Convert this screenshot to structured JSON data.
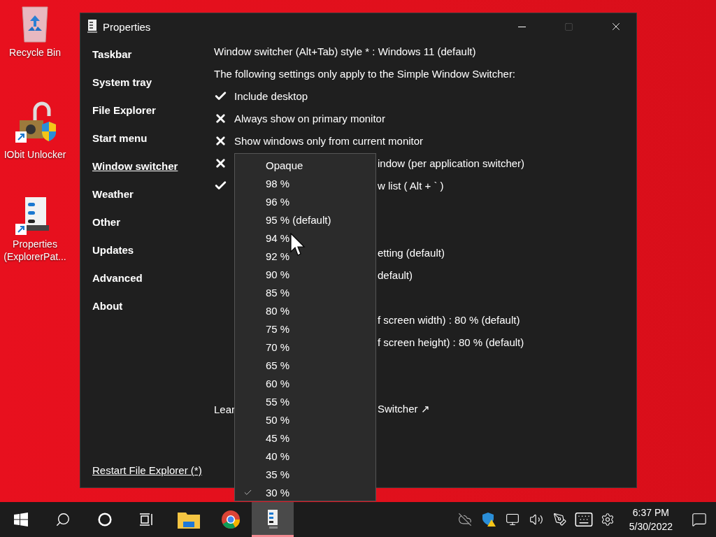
{
  "desktop_icons": [
    {
      "kind": "recycle",
      "label": "Recycle Bin"
    },
    {
      "kind": "unlocker",
      "label": "IObit Unlocker"
    },
    {
      "kind": "properties",
      "label": "Properties (ExplorerPat..."
    }
  ],
  "window": {
    "title": "Properties",
    "sidebar": [
      {
        "label": "Taskbar",
        "selected": false
      },
      {
        "label": "System tray",
        "selected": false
      },
      {
        "label": "File Explorer",
        "selected": false
      },
      {
        "label": "Start menu",
        "selected": false
      },
      {
        "label": "Window switcher",
        "selected": true
      },
      {
        "label": "Weather",
        "selected": false
      },
      {
        "label": "Other",
        "selected": false
      },
      {
        "label": "Updates",
        "selected": false
      },
      {
        "label": "Advanced",
        "selected": false
      },
      {
        "label": "About",
        "selected": false
      }
    ],
    "restart_link": "Restart File Explorer (*)",
    "settings": [
      {
        "kind": "text",
        "text": "Window switcher (Alt+Tab) style * : Windows 11 (default)"
      },
      {
        "kind": "text",
        "text": "The following settings only apply to the Simple Window Switcher:"
      },
      {
        "kind": "check",
        "text": "Include desktop",
        "checked": true
      },
      {
        "kind": "check",
        "text": "Always show on primary monitor",
        "checked": false
      },
      {
        "kind": "check",
        "text": "Show windows only from current monitor",
        "checked": false
      },
      {
        "kind": "check",
        "tail": "indow (per application switcher)",
        "checked": false
      },
      {
        "kind": "check",
        "tail": "w list ( Alt + ` )",
        "checked": true
      },
      {
        "kind": "blank"
      },
      {
        "kind": "blank"
      },
      {
        "kind": "option",
        "tail": "etting (default)"
      },
      {
        "kind": "option",
        "tail": "default)"
      },
      {
        "kind": "blank"
      },
      {
        "kind": "option",
        "tail": "f screen width) : 80 % (default)"
      },
      {
        "kind": "option",
        "tail": "f screen height) : 80 % (default)"
      },
      {
        "kind": "blank"
      },
      {
        "kind": "blank"
      },
      {
        "kind": "link",
        "text": "Lear",
        "tail": "Switcher ↗"
      }
    ],
    "dropdown": {
      "items": [
        {
          "label": "Opaque",
          "selected": false
        },
        {
          "label": "98 %",
          "selected": false
        },
        {
          "label": "96 %",
          "selected": false
        },
        {
          "label": "95 % (default)",
          "selected": false
        },
        {
          "label": "94 %",
          "selected": false
        },
        {
          "label": "92 %",
          "selected": false
        },
        {
          "label": "90 %",
          "selected": false
        },
        {
          "label": "85 %",
          "selected": false
        },
        {
          "label": "80 %",
          "selected": false
        },
        {
          "label": "75 %",
          "selected": false
        },
        {
          "label": "70 %",
          "selected": false
        },
        {
          "label": "65 %",
          "selected": false
        },
        {
          "label": "60 %",
          "selected": false
        },
        {
          "label": "55 %",
          "selected": false
        },
        {
          "label": "50 %",
          "selected": false
        },
        {
          "label": "45 %",
          "selected": false
        },
        {
          "label": "40 %",
          "selected": false
        },
        {
          "label": "35 %",
          "selected": false
        },
        {
          "label": "30 %",
          "selected": true
        }
      ]
    }
  },
  "taskbar": {
    "apps": [
      {
        "kind": "start",
        "selected": false
      },
      {
        "kind": "search",
        "selected": false
      },
      {
        "kind": "cortana",
        "selected": false
      },
      {
        "kind": "taskview",
        "selected": false
      },
      {
        "kind": "explorer",
        "selected": false
      },
      {
        "kind": "chrome",
        "selected": false
      },
      {
        "kind": "properties",
        "selected": true
      }
    ],
    "tray": [
      {
        "kind": "cloud"
      },
      {
        "kind": "shield"
      },
      {
        "kind": "network"
      },
      {
        "kind": "volume"
      },
      {
        "kind": "pen"
      },
      {
        "kind": "keyboard"
      },
      {
        "kind": "gear"
      }
    ],
    "clock": {
      "time": "6:37 PM",
      "date": "5/30/2022"
    }
  }
}
